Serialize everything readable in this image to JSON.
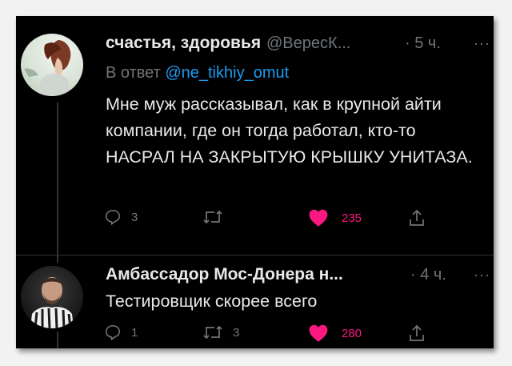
{
  "tweets": [
    {
      "display_name": "счастья, здоровья",
      "handle": "@ВересК...",
      "time": "· 5 ч.",
      "reply_label": "В ответ",
      "reply_mention": "@ne_tikhiy_omut",
      "text": "Мне муж рассказывал, как в крупной айти компании, где он тогда работал, кто-то НАСРАЛ НА ЗАКРЫТУЮ КРЫШКУ УНИТАЗА.",
      "replies": "3",
      "retweets": "",
      "likes": "235",
      "liked": true
    },
    {
      "display_name": "Амбассадор Мос-Донера н...",
      "time": "· 4 ч.",
      "text": "Тестировщик скорее всего",
      "replies": "1",
      "retweets": "3",
      "likes": "280",
      "liked": true
    }
  ],
  "icons": {
    "reply": "speech-bubble-icon",
    "retweet": "retweet-arrows-icon",
    "like": "heart-icon",
    "share": "share-upload-icon",
    "more": "ellipsis-icon"
  },
  "colors": {
    "background": "#000000",
    "text": "#e7e9ea",
    "muted": "#71767b",
    "mention": "#1d9bf0",
    "like": "#f91880"
  },
  "more_glyph": "···"
}
